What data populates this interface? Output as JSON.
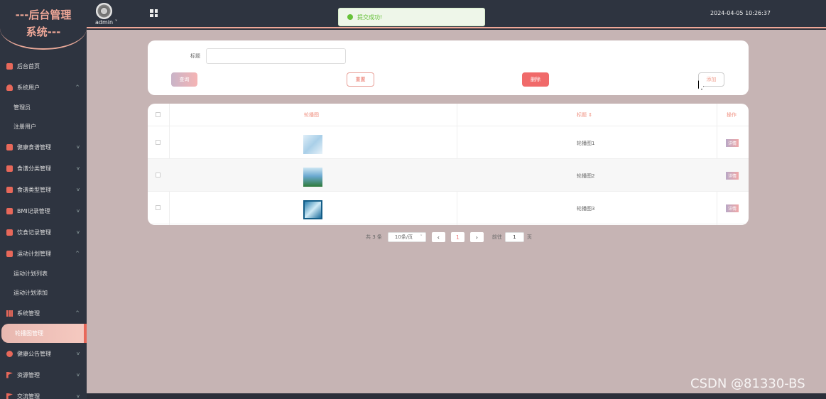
{
  "sidebar": {
    "logo_line1": "---后台管理",
    "logo_line2": "系统---",
    "items": [
      {
        "label": "后台首页"
      },
      {
        "label": "系统用户"
      },
      {
        "label": "管理员"
      },
      {
        "label": "注册用户"
      },
      {
        "label": "健康食谱管理"
      },
      {
        "label": "食谱分类管理"
      },
      {
        "label": "食谱类型管理"
      },
      {
        "label": "BMI记录管理"
      },
      {
        "label": "饮食记录管理"
      },
      {
        "label": "运动计划管理"
      },
      {
        "label": "运动计划列表"
      },
      {
        "label": "运动计划添加"
      },
      {
        "label": "系统管理"
      },
      {
        "label": "轮播图管理"
      },
      {
        "label": "健康公告管理"
      },
      {
        "label": "资源管理"
      },
      {
        "label": "交流管理"
      }
    ]
  },
  "header": {
    "username": "admin",
    "datetime": "2024-04-05 10:26:37",
    "toast": "提交成功!"
  },
  "search": {
    "title_label": "标题",
    "title_value": "",
    "query_label": "查询",
    "reset_label": "重置",
    "delete_label": "删除",
    "add_label": "添加"
  },
  "table": {
    "headers": {
      "image": "轮播图",
      "title": "标题",
      "action": "操作"
    },
    "rows": [
      {
        "title": "轮播图1",
        "action": "详情"
      },
      {
        "title": "轮播图2",
        "action": "详情"
      },
      {
        "title": "轮播图3",
        "action": "详情"
      }
    ]
  },
  "pager": {
    "total": "共 3 条",
    "page_size": "10条/页",
    "current": "1",
    "goto_label": "前往",
    "goto_value": "1",
    "page_suffix": "页"
  },
  "watermark": "CSDN @81330-BS",
  "colors": {
    "accent": "#e8685a",
    "sidebar_bg": "#2e3440",
    "main_bg": "#c6b4b4"
  }
}
